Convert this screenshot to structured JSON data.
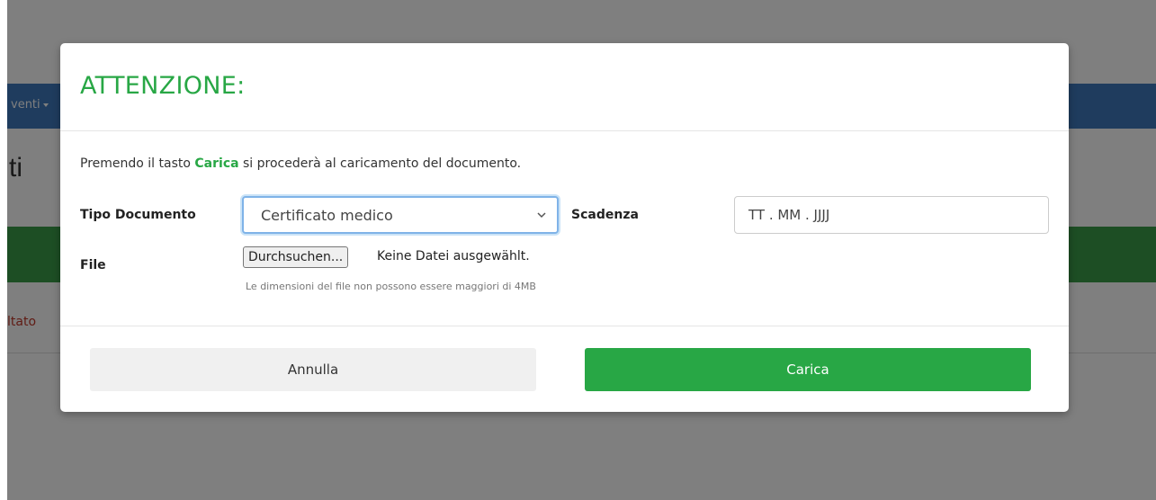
{
  "background": {
    "navbar_item": "venti",
    "heading": "ti",
    "result_text": "ltato"
  },
  "modal": {
    "title": "ATTENZIONE:",
    "intro": {
      "before": "Premendo il tasto ",
      "emphasis": "Carica",
      "after": " si procederà al caricamento del documento."
    },
    "tipo_documento": {
      "label": "Tipo Documento",
      "selected": "Certificato medico"
    },
    "scadenza": {
      "label": "Scadenza",
      "value": "TT . MM . JJJJ"
    },
    "file": {
      "label": "File",
      "button_label": "Durchsuchen...",
      "status": "Keine Datei ausgewählt.",
      "help": "Le dimensioni del file non possono essere maggiori di 4MB"
    },
    "footer": {
      "cancel_label": "Annulla",
      "submit_label": "Carica"
    }
  },
  "colors": {
    "accent_green": "#28a745",
    "navbar_blue": "#3e79bd",
    "overlay": "rgba(0,0,0,0.5)"
  }
}
